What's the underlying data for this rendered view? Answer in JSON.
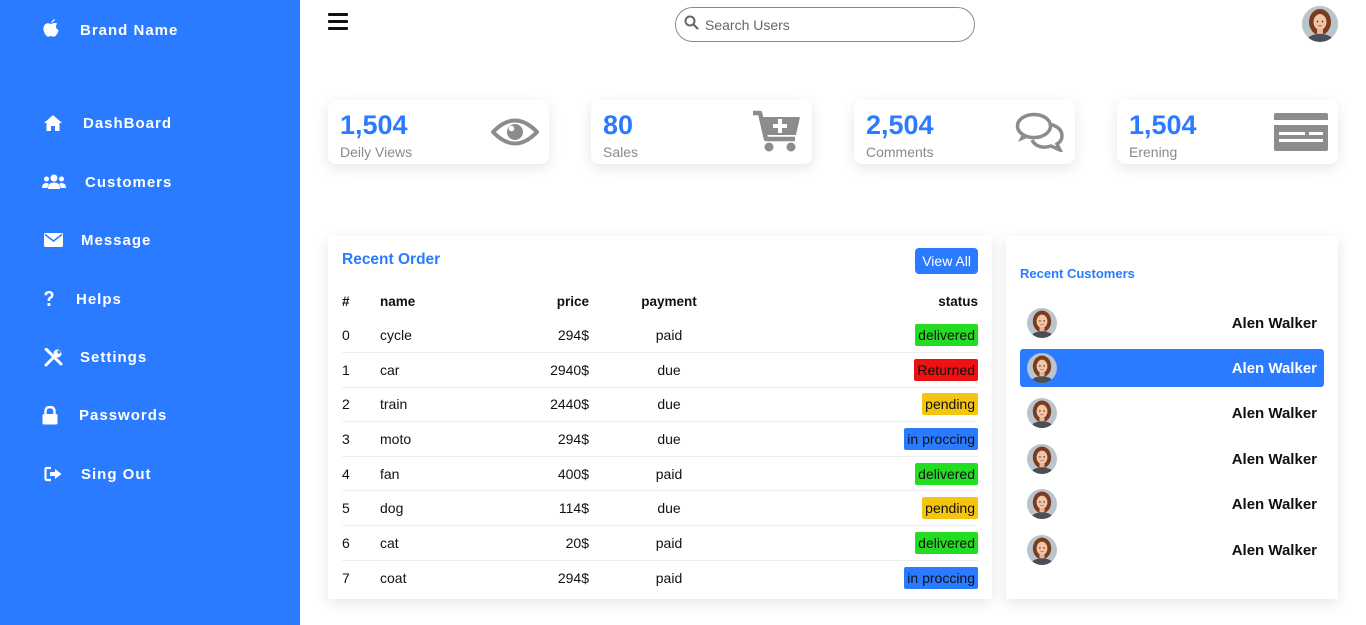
{
  "colors": {
    "primary": "#2a7bff",
    "delivered": "#22dd22",
    "returned": "#ee1111",
    "pending": "#f5c40f",
    "in_progress": "#2a7bff"
  },
  "sidebar": {
    "brand": {
      "icon": "apple-icon",
      "label": "Brand Name"
    },
    "items": [
      {
        "icon": "home-icon",
        "label": "DashBoard"
      },
      {
        "icon": "users-icon",
        "label": "Customers"
      },
      {
        "icon": "envelope-icon",
        "label": "Message"
      },
      {
        "icon": "question-icon",
        "label": "Helps"
      },
      {
        "icon": "tools-icon",
        "label": "Settings"
      },
      {
        "icon": "lock-icon",
        "label": "Passwords"
      },
      {
        "icon": "sign-out-icon",
        "label": "Sing Out"
      }
    ]
  },
  "topbar": {
    "search_placeholder": "Search Users"
  },
  "cards": [
    {
      "number": "1,504",
      "caption": "Deily Views",
      "icon": "eye-icon"
    },
    {
      "number": "80",
      "caption": "Sales",
      "icon": "cart-plus-icon"
    },
    {
      "number": "2,504",
      "caption": "Comments",
      "icon": "comments-icon"
    },
    {
      "number": "1,504",
      "caption": "Erening",
      "icon": "credit-card-icon"
    }
  ],
  "orders": {
    "title": "Recent Order",
    "view_all": "View All",
    "headers": [
      "#",
      "name",
      "price",
      "payment",
      "status"
    ],
    "rows": [
      {
        "idx": "0",
        "name": "cycle",
        "price": "294$",
        "payment": "paid",
        "status": "delivered"
      },
      {
        "idx": "1",
        "name": "car",
        "price": "2940$",
        "payment": "due",
        "status": "Returned"
      },
      {
        "idx": "2",
        "name": "train",
        "price": "2440$",
        "payment": "due",
        "status": "pending"
      },
      {
        "idx": "3",
        "name": "moto",
        "price": "294$",
        "payment": "due",
        "status": "in proccing"
      },
      {
        "idx": "4",
        "name": "fan",
        "price": "400$",
        "payment": "paid",
        "status": "delivered"
      },
      {
        "idx": "5",
        "name": "dog",
        "price": "114$",
        "payment": "due",
        "status": "pending"
      },
      {
        "idx": "6",
        "name": "cat",
        "price": "20$",
        "payment": "paid",
        "status": "delivered"
      },
      {
        "idx": "7",
        "name": "coat",
        "price": "294$",
        "payment": "paid",
        "status": "in proccing"
      }
    ]
  },
  "customers": {
    "title": "Recent Customers",
    "items": [
      {
        "name": "Alen Walker",
        "active": false
      },
      {
        "name": "Alen Walker",
        "active": true
      },
      {
        "name": "Alen Walker",
        "active": false
      },
      {
        "name": "Alen Walker",
        "active": false
      },
      {
        "name": "Alen Walker",
        "active": false
      },
      {
        "name": "Alen Walker",
        "active": false
      }
    ]
  }
}
